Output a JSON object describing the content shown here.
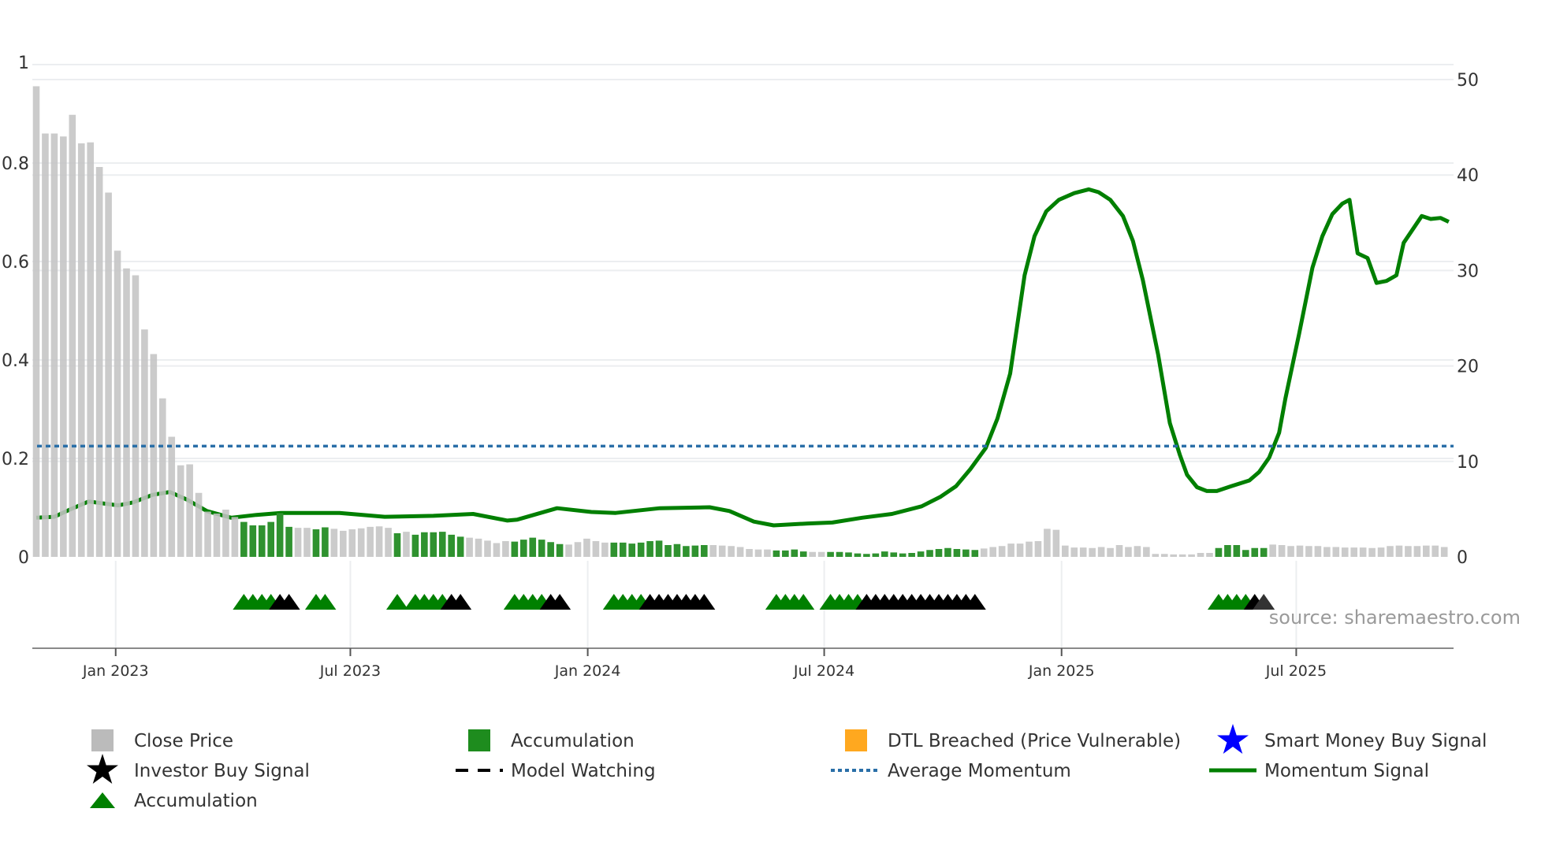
{
  "chart_data": {
    "type": "bar",
    "title": "",
    "x_unit": "week index (weekly bars, ~Nov 2022 to Oct 2025)",
    "x_ticks": [
      {
        "label": "Jan 2023",
        "week": 8.8
      },
      {
        "label": "Jul 2023",
        "week": 34.8
      },
      {
        "label": "Jan 2024",
        "week": 61.1
      },
      {
        "label": "Jul 2024",
        "week": 87.3
      },
      {
        "label": "Jan 2025",
        "week": 113.6
      },
      {
        "label": "Jul 2025",
        "week": 139.6
      }
    ],
    "left_axis": {
      "label": "Close Price",
      "ylim": [
        0,
        1
      ],
      "ticks": [
        "0",
        "0.2",
        "0.4",
        "0.6",
        "0.8",
        "1"
      ]
    },
    "right_axis": {
      "label": "Momentum",
      "ylim": [
        0,
        50
      ],
      "ticks": [
        "0",
        "10",
        "20",
        "30",
        "40",
        "50"
      ]
    },
    "close_price": [
      0.956,
      0.86,
      0.86,
      0.854,
      0.898,
      0.84,
      0.842,
      0.792,
      0.74,
      0.622,
      0.586,
      0.572,
      0.462,
      0.412,
      0.322,
      0.244,
      0.186,
      0.188,
      0.13,
      0.092,
      0.088,
      0.096,
      0.081,
      0.071,
      0.064,
      0.064,
      0.071,
      0.089,
      0.061,
      0.059,
      0.059,
      0.056,
      0.06,
      0.057,
      0.053,
      0.056,
      0.058,
      0.061,
      0.062,
      0.059,
      0.048,
      0.051,
      0.045,
      0.05,
      0.05,
      0.051,
      0.045,
      0.041,
      0.039,
      0.037,
      0.033,
      0.028,
      0.032,
      0.031,
      0.035,
      0.039,
      0.035,
      0.03,
      0.026,
      0.025,
      0.03,
      0.037,
      0.032,
      0.029,
      0.029,
      0.029,
      0.027,
      0.029,
      0.032,
      0.033,
      0.024,
      0.026,
      0.022,
      0.023,
      0.024,
      0.024,
      0.023,
      0.022,
      0.02,
      0.016,
      0.015,
      0.015,
      0.013,
      0.013,
      0.015,
      0.011,
      0.01,
      0.01,
      0.01,
      0.01,
      0.009,
      0.007,
      0.006,
      0.007,
      0.011,
      0.009,
      0.007,
      0.008,
      0.011,
      0.014,
      0.016,
      0.018,
      0.016,
      0.015,
      0.014,
      0.017,
      0.02,
      0.022,
      0.027,
      0.027,
      0.031,
      0.032,
      0.057,
      0.055,
      0.023,
      0.019,
      0.019,
      0.018,
      0.02,
      0.018,
      0.024,
      0.02,
      0.022,
      0.02,
      0.006,
      0.006,
      0.005,
      0.005,
      0.005,
      0.008,
      0.008,
      0.018,
      0.024,
      0.024,
      0.014,
      0.018,
      0.018,
      0.025,
      0.024,
      0.022,
      0.023,
      0.022,
      0.022,
      0.02,
      0.02,
      0.019,
      0.019,
      0.019,
      0.018,
      0.019,
      0.022,
      0.023,
      0.022,
      0.022,
      0.023,
      0.023,
      0.02
    ],
    "accumulation_weeks": [
      23,
      24,
      25,
      26,
      27,
      28,
      31,
      32,
      40,
      42,
      43,
      44,
      45,
      46,
      47,
      53,
      54,
      55,
      56,
      57,
      58,
      64,
      65,
      66,
      67,
      68,
      69,
      70,
      71,
      72,
      73,
      74,
      82,
      83,
      84,
      85,
      88,
      89,
      90,
      91,
      92,
      93,
      94,
      95,
      96,
      97,
      98,
      99,
      100,
      101,
      102,
      103,
      104,
      131,
      132,
      133,
      134,
      135,
      136
    ],
    "momentum_signal": [
      [
        0,
        4.1
      ],
      [
        2,
        4.2
      ],
      [
        3.6,
        4.9
      ],
      [
        5.8,
        5.8
      ],
      [
        7.4,
        5.6
      ],
      [
        9.1,
        5.4
      ],
      [
        10.7,
        5.7
      ],
      [
        12.9,
        6.5
      ],
      [
        14.8,
        6.8
      ],
      [
        16.7,
        6.0
      ],
      [
        18.9,
        4.8
      ],
      [
        21.6,
        4.1
      ],
      [
        24.4,
        4.4
      ],
      [
        27.1,
        4.6
      ],
      [
        33.6,
        4.6
      ],
      [
        38.6,
        4.2
      ],
      [
        44,
        4.3
      ],
      [
        48.4,
        4.5
      ],
      [
        52.2,
        3.8
      ],
      [
        53.3,
        3.9
      ],
      [
        57.7,
        5.1
      ],
      [
        61.5,
        4.7
      ],
      [
        64.2,
        4.6
      ],
      [
        69.1,
        5.1
      ],
      [
        74.6,
        5.2
      ],
      [
        76.8,
        4.8
      ],
      [
        79.5,
        3.7
      ],
      [
        81.7,
        3.3
      ],
      [
        85.5,
        3.5
      ],
      [
        88.2,
        3.6
      ],
      [
        91.5,
        4.1
      ],
      [
        94.8,
        4.5
      ],
      [
        98.1,
        5.3
      ],
      [
        100.2,
        6.3
      ],
      [
        101.9,
        7.4
      ],
      [
        103.5,
        9.2
      ],
      [
        105.2,
        11.4
      ],
      [
        106.5,
        14.5
      ],
      [
        107.9,
        19.2
      ],
      [
        109.5,
        29.5
      ],
      [
        110.6,
        33.6
      ],
      [
        111.9,
        36.2
      ],
      [
        113.3,
        37.4
      ],
      [
        115,
        38.1
      ],
      [
        116.6,
        38.5
      ],
      [
        117.7,
        38.2
      ],
      [
        119,
        37.4
      ],
      [
        120.4,
        35.7
      ],
      [
        121.5,
        33.1
      ],
      [
        122.6,
        29
      ],
      [
        124.3,
        21.2
      ],
      [
        125.6,
        14
      ],
      [
        126.7,
        10.7
      ],
      [
        127.5,
        8.6
      ],
      [
        128.6,
        7.3
      ],
      [
        129.7,
        6.9
      ],
      [
        130.8,
        6.9
      ],
      [
        132.4,
        7.4
      ],
      [
        134.4,
        8
      ],
      [
        135.5,
        8.9
      ],
      [
        136.6,
        10.4
      ],
      [
        137.7,
        13
      ],
      [
        138.4,
        16.6
      ],
      [
        139.9,
        23.3
      ],
      [
        141.4,
        30.3
      ],
      [
        142.5,
        33.6
      ],
      [
        143.6,
        35.9
      ],
      [
        144.7,
        37
      ],
      [
        145.5,
        37.4
      ],
      [
        146.4,
        31.8
      ],
      [
        147.5,
        31.3
      ],
      [
        148.5,
        28.7
      ],
      [
        149.6,
        28.9
      ],
      [
        150.7,
        29.5
      ],
      [
        151.5,
        32.9
      ],
      [
        153.5,
        35.7
      ],
      [
        154.5,
        35.4
      ],
      [
        155.6,
        35.5
      ],
      [
        156.5,
        35.1
      ]
    ],
    "average_momentum": 11.6,
    "accumulation_signal_weeks": [
      23,
      24,
      25,
      26,
      31,
      32,
      40,
      42,
      43,
      44,
      45,
      53,
      54,
      55,
      56,
      64,
      65,
      66,
      67,
      82,
      83,
      84,
      85,
      88,
      89,
      90,
      91,
      131,
      132,
      133,
      134
    ],
    "investor_buy_signal_weeks": [
      27,
      28,
      46,
      47,
      57,
      58,
      68,
      69,
      70,
      71,
      72,
      73,
      74,
      92,
      93,
      94,
      95,
      96,
      97,
      98,
      99,
      100,
      101,
      102,
      103,
      104,
      135
    ],
    "faded_signal_weeks": [
      136
    ],
    "legend": [
      {
        "label": "Close Price",
        "icon": "gray-square"
      },
      {
        "label": "Accumulation",
        "icon": "green-square"
      },
      {
        "label": "DTL Breached (Price Vulnerable)",
        "icon": "orange-square"
      },
      {
        "label": "Smart Money Buy Signal",
        "icon": "blue-star"
      },
      {
        "label": "Investor Buy Signal",
        "icon": "black-star"
      },
      {
        "label": "Model Watching",
        "icon": "black-dashed-line"
      },
      {
        "label": "Average Momentum",
        "icon": "blue-dotted-line"
      },
      {
        "label": "Momentum Signal",
        "icon": "green-line"
      },
      {
        "label": "Accumulation",
        "icon": "green-triangle"
      }
    ],
    "legend_placement": "bottom",
    "grid": true
  },
  "source": "source: sharemaestro.com",
  "colors": {
    "close_bar": "#c4c4c4",
    "accum_bar": "#2f922f",
    "momentum": "#007f00",
    "avg_momentum": "#2a6fa8",
    "accum_triangle": "#008000",
    "investor_triangle": "#000000",
    "dtl": "#ffa81f",
    "smart_money": "#0000ff",
    "grid": "#eceef0",
    "axis": "#8a8a8a"
  }
}
